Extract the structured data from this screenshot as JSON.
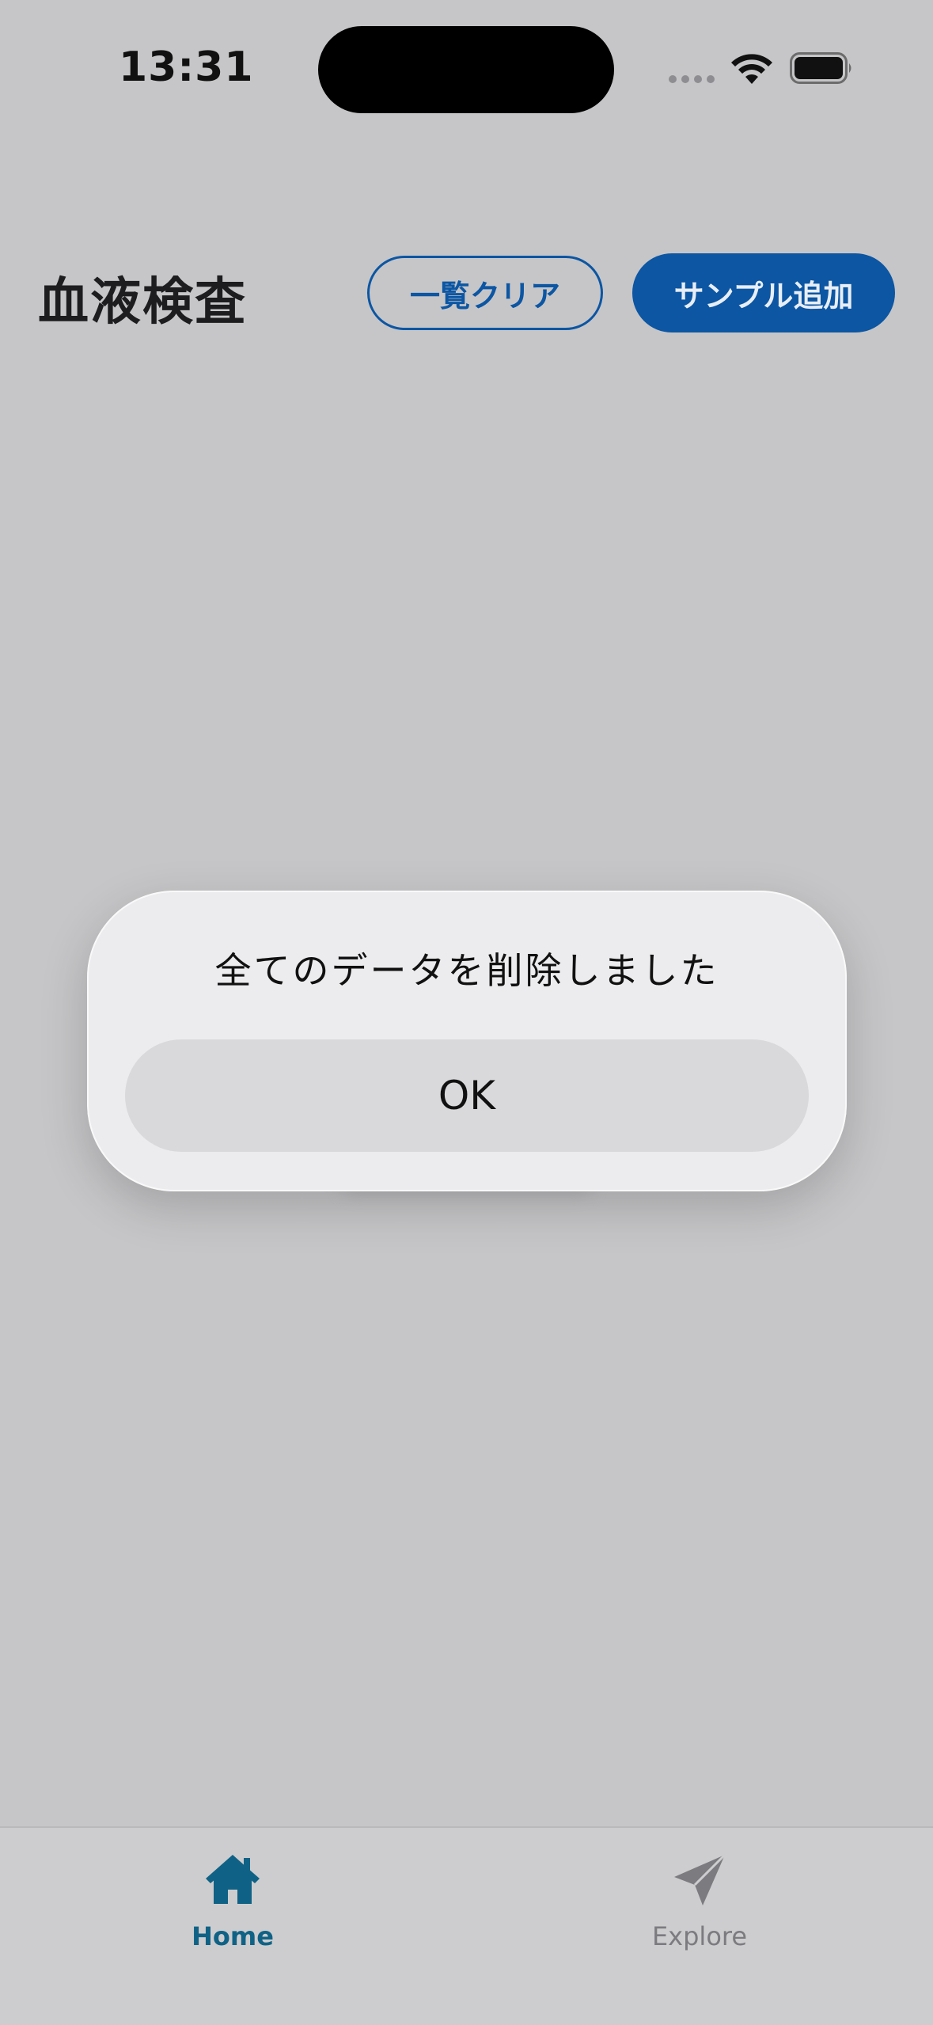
{
  "status_bar": {
    "time": "13:31"
  },
  "header": {
    "title": "血液検査",
    "clear_button_label": "一覧クリア",
    "add_sample_button_label": "サンプル追加"
  },
  "alert": {
    "message": "全てのデータを削除しました",
    "ok_label": "OK"
  },
  "tabbar": {
    "items": [
      {
        "label": "Home",
        "icon": "home-icon",
        "selected": true
      },
      {
        "label": "Explore",
        "icon": "paper-plane-icon",
        "selected": false
      }
    ]
  },
  "colors": {
    "accent": "#0c56a3",
    "tab_selected": "#0f6285",
    "tab_unselected": "#7b7b80",
    "background": "#c6c6c8"
  }
}
